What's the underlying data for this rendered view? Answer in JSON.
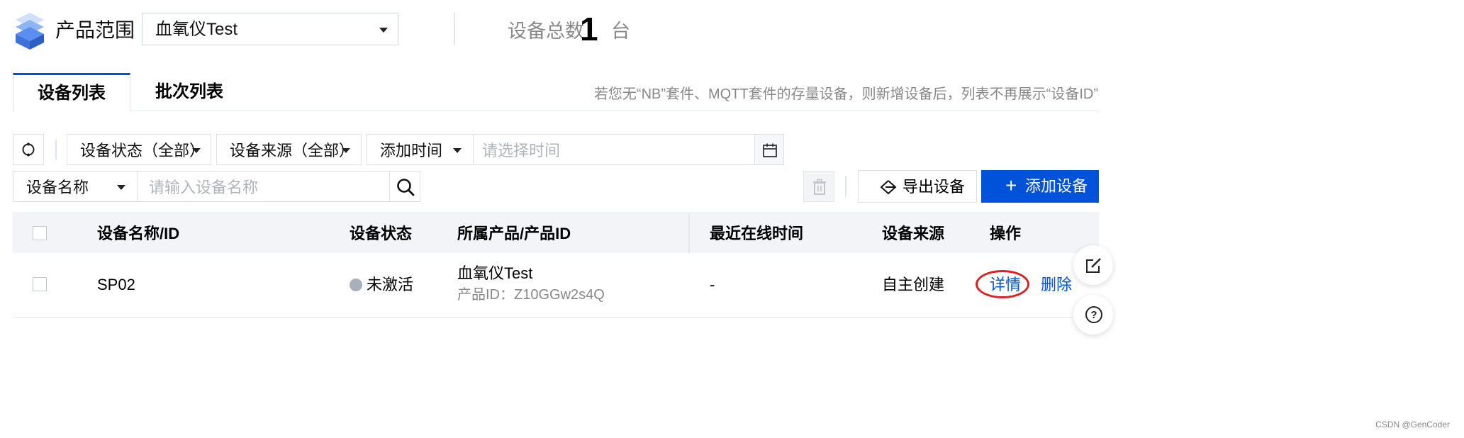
{
  "header": {
    "product_scope_label": "产品范围",
    "product_selected": "血氧仪Test",
    "device_total_label": "设备总数",
    "device_total_count": "1",
    "device_total_unit": "台"
  },
  "tabs": [
    {
      "label": "设备列表",
      "active": true
    },
    {
      "label": "批次列表",
      "active": false
    }
  ],
  "notice": "若您无“NB”套件、MQTT套件的存量设备，则新增设备后，列表不再展示“设备ID”",
  "filters": {
    "status_label": "设备状态（全部）",
    "source_label": "设备来源（全部）",
    "time_label": "添加时间",
    "time_placeholder": "请选择时间",
    "name_field_label": "设备名称",
    "name_placeholder": "请输入设备名称"
  },
  "toolbar": {
    "export_label": "导出设备",
    "add_label": "添加设备"
  },
  "table": {
    "columns": [
      "设备名称/ID",
      "设备状态",
      "所属产品/产品ID",
      "最近在线时间",
      "设备来源",
      "操作"
    ],
    "rows": [
      {
        "name": "SP02",
        "status": "未激活",
        "product_name": "血氧仪Test",
        "product_id": "产品ID：Z10GGw2s4Q",
        "last_online": "-",
        "source": "自主创建",
        "actions": [
          "详情",
          "删除"
        ]
      }
    ]
  },
  "watermark": "CSDN @GenCoder",
  "colors": {
    "primary": "#0052d9",
    "annotation_red": "#e02020",
    "muted_text": "#888888"
  },
  "icons": {
    "product": "product-cube-icon",
    "refresh": "refresh-icon",
    "calendar": "calendar-icon",
    "search": "search-icon",
    "delete": "trash-icon",
    "export": "export-icon",
    "edit": "edit-icon",
    "help": "help-icon"
  }
}
